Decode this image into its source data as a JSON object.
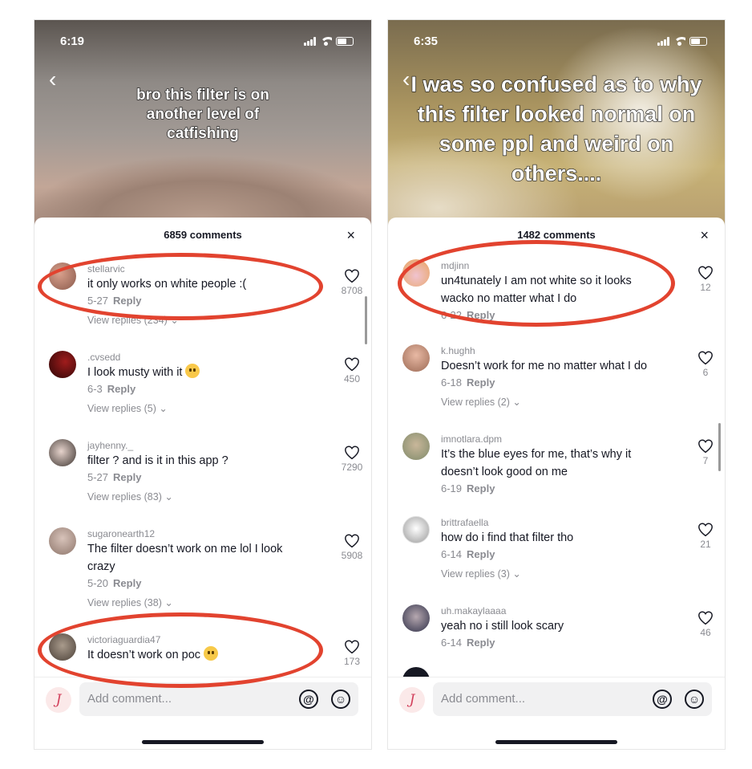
{
  "left": {
    "time": "6:19",
    "caption": "bro this filter is on another level of catfishing",
    "comments_count": "6859 comments",
    "close": "×",
    "add_comment_placeholder": "Add comment...",
    "comments": [
      {
        "user": "stellarvic",
        "text": "it only works on white people :(",
        "date": "5-27",
        "reply": "Reply",
        "likes": "8708",
        "view_replies": "View replies (234)",
        "avatar_color": "#8a5a4c"
      },
      {
        "user": ".cvsedd",
        "text": "I look musty with it",
        "date": "6-3",
        "reply": "Reply",
        "likes": "450",
        "view_replies": "View replies (5)",
        "avatar_color": "#5a1414",
        "emoji": "crying-emoji"
      },
      {
        "user": "jayhenny._",
        "text": "filter ? and is it in this app ?",
        "date": "5-27",
        "reply": "Reply",
        "likes": "7290",
        "view_replies": "View replies (83)",
        "avatar_color": "#3b332f"
      },
      {
        "user": "sugaronearth12",
        "text": "The filter doesn’t work on me lol I look crazy",
        "date": "5-20",
        "reply": "Reply",
        "likes": "5908",
        "view_replies": "View replies (38)",
        "avatar_color": "#b39c92"
      },
      {
        "user": "victoriaguardia47",
        "text": "It doesn’t work on poc",
        "date": "",
        "reply": "",
        "likes": "173",
        "view_replies": "",
        "avatar_color": "#6f6257",
        "emoji": "upside-down-emoji"
      }
    ]
  },
  "right": {
    "time": "6:35",
    "caption": "I was so confused as to why this filter looked normal on some ppl and weird on others....",
    "comments_count": "1482 comments",
    "close": "×",
    "add_comment_placeholder": "Add comment...",
    "comments": [
      {
        "user": "mdjinn",
        "text": "un4tunately I am not white so it looks wacko no matter what I do",
        "date": "6-22",
        "reply": "Reply",
        "likes": "12",
        "view_replies": "",
        "avatar_color": "#e8a35c"
      },
      {
        "user": "k.hughh",
        "text": "Doesn’t work for me no matter what I do",
        "date": "6-18",
        "reply": "Reply",
        "likes": "6",
        "view_replies": "View replies (2)",
        "avatar_color": "#9c6a55"
      },
      {
        "user": "imnotlara.dpm",
        "text": "It’s the blue eyes for me, that’s why it doesn’t look good on me",
        "date": "6-19",
        "reply": "Reply",
        "likes": "7",
        "view_replies": "",
        "avatar_color": "#7f8a6a"
      },
      {
        "user": "brittrafaella",
        "text": "how do i find that filter tho",
        "date": "6-14",
        "reply": "Reply",
        "likes": "21",
        "view_replies": "View replies (3)",
        "avatar_color": "#d9d9d9"
      },
      {
        "user": "uh.makaylaaaa",
        "text": "yeah no i still look scary",
        "date": "6-14",
        "reply": "Reply",
        "likes": "46",
        "view_replies": "",
        "avatar_color": "#4c4f6b"
      }
    ]
  },
  "colors": {
    "highlight_ring": "#e2432f",
    "text": "#161823",
    "muted": "#8a8b91"
  }
}
